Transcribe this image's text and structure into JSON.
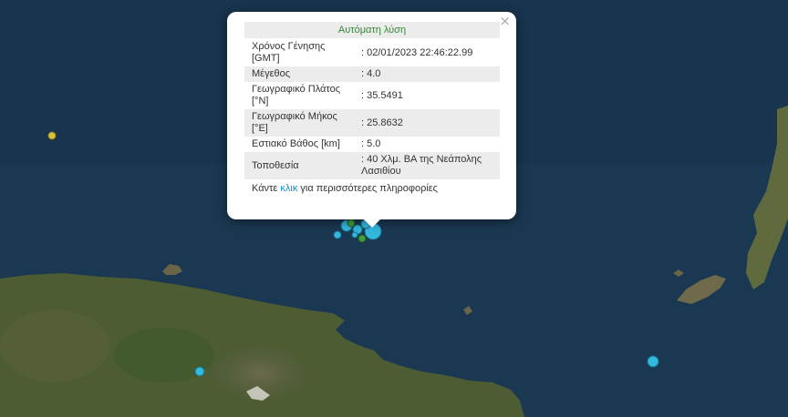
{
  "popup": {
    "title": "Αυτόματη λύση",
    "close": "×",
    "rows": [
      {
        "label": "Χρόνος Γένησης [GMT]",
        "value": ": 02/01/2023 22:46:22.99"
      },
      {
        "label": "Μέγεθος",
        "value": ": 4.0"
      },
      {
        "label": "Γεωγραφικό Πλάτος [°N]",
        "value": ": 35.5491"
      },
      {
        "label": "Γεωγραφικό Μήκος [°E]",
        "value": ": 25.8632"
      },
      {
        "label": "Εστιακό Βάθος [km]",
        "value": ": 5.0"
      },
      {
        "label": "Τοποθεσία",
        "value": ": 40 Χλμ. ΒΑ της Νεάπολης Λασιθίου"
      }
    ],
    "more_prefix": "Κάντε ",
    "more_link": "κλικ",
    "more_suffix": " για περισσότερες πληροφορίες"
  },
  "colors": {
    "sea": "#1b3852",
    "land": "#4a5a32",
    "event_cyan": "#33b8de",
    "event_green": "#3fa03f",
    "event_yellow": "#d8c23a"
  }
}
